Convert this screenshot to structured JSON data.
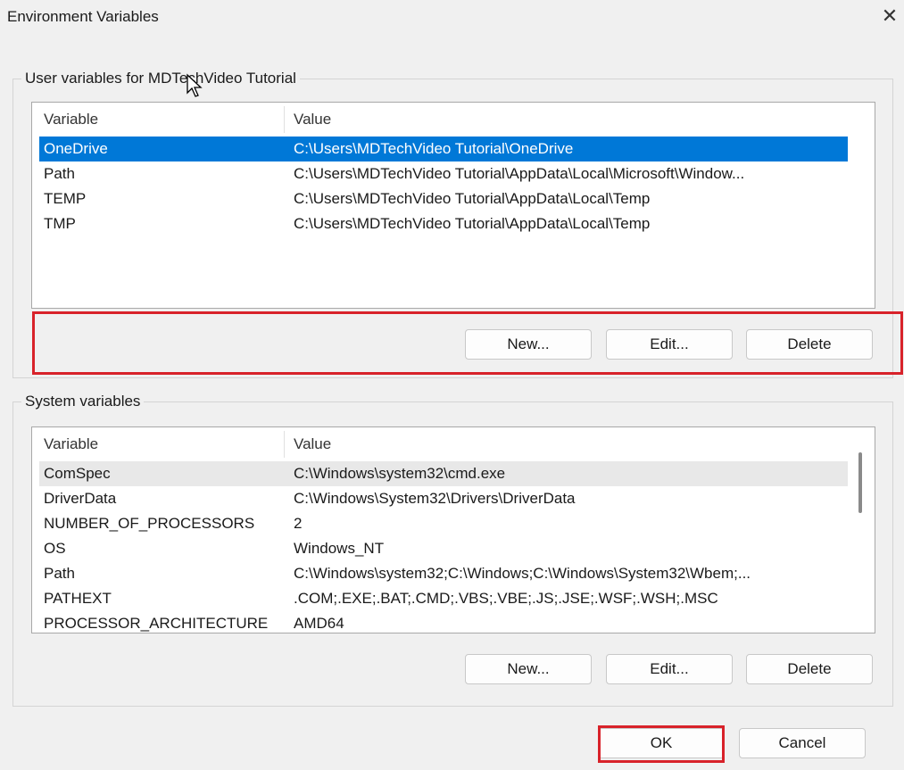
{
  "window": {
    "title": "Environment Variables",
    "close_glyph": "✕"
  },
  "user_vars": {
    "label": "User variables for MDTechVideo Tutorial",
    "columns": {
      "variable": "Variable",
      "value": "Value"
    },
    "rows": [
      {
        "name": "OneDrive",
        "value": "C:\\Users\\MDTechVideo Tutorial\\OneDrive"
      },
      {
        "name": "Path",
        "value": "C:\\Users\\MDTechVideo Tutorial\\AppData\\Local\\Microsoft\\Window..."
      },
      {
        "name": "TEMP",
        "value": "C:\\Users\\MDTechVideo Tutorial\\AppData\\Local\\Temp"
      },
      {
        "name": "TMP",
        "value": "C:\\Users\\MDTechVideo Tutorial\\AppData\\Local\\Temp"
      }
    ],
    "buttons": {
      "new": "New...",
      "edit": "Edit...",
      "delete": "Delete"
    }
  },
  "system_vars": {
    "label": "System variables",
    "columns": {
      "variable": "Variable",
      "value": "Value"
    },
    "rows": [
      {
        "name": "ComSpec",
        "value": "C:\\Windows\\system32\\cmd.exe"
      },
      {
        "name": "DriverData",
        "value": "C:\\Windows\\System32\\Drivers\\DriverData"
      },
      {
        "name": "NUMBER_OF_PROCESSORS",
        "value": "2"
      },
      {
        "name": "OS",
        "value": "Windows_NT"
      },
      {
        "name": "Path",
        "value": "C:\\Windows\\system32;C:\\Windows;C:\\Windows\\System32\\Wbem;..."
      },
      {
        "name": "PATHEXT",
        "value": ".COM;.EXE;.BAT;.CMD;.VBS;.VBE;.JS;.JSE;.WSF;.WSH;.MSC"
      },
      {
        "name": "PROCESSOR_ARCHITECTURE",
        "value": "AMD64"
      }
    ],
    "buttons": {
      "new": "New...",
      "edit": "Edit...",
      "delete": "Delete"
    }
  },
  "footer": {
    "ok": "OK",
    "cancel": "Cancel"
  },
  "colors": {
    "selection": "#0078d7",
    "highlight": "#d8222a"
  }
}
